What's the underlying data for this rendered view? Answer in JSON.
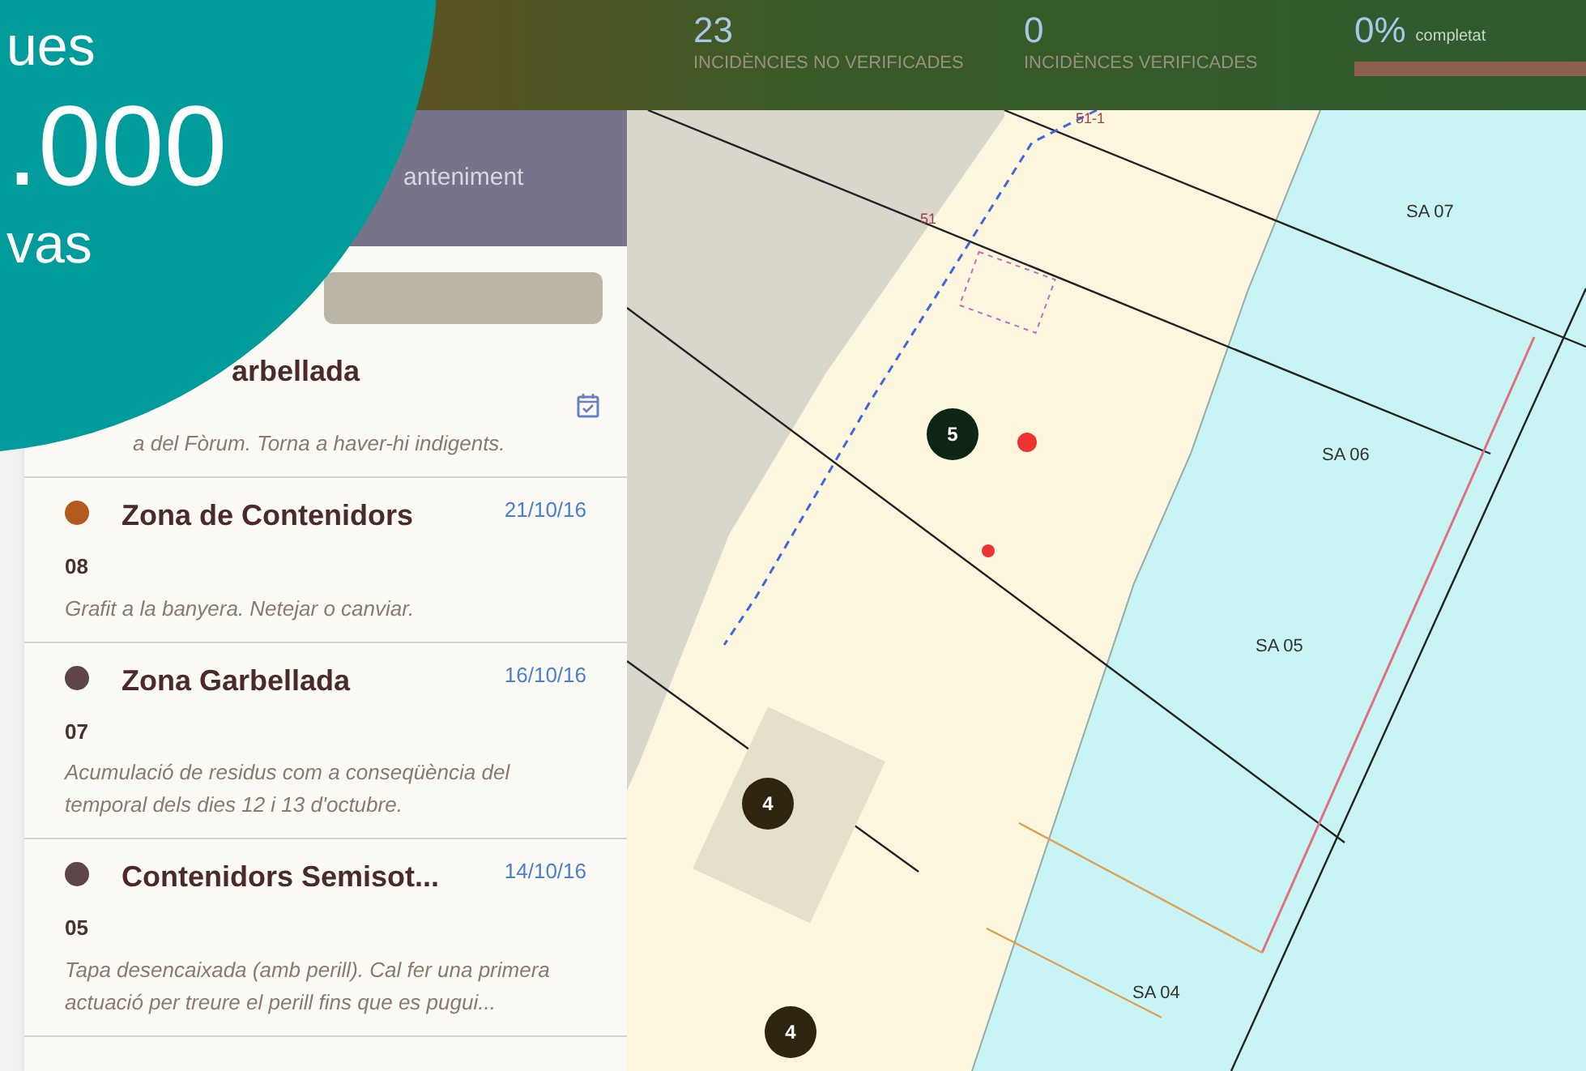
{
  "promo_overlay": {
    "lines": [
      "ues",
      ".000",
      "vas"
    ]
  },
  "stats": [
    {
      "value": "23",
      "label": "INCIDÈNCIES NO VERIFICADES"
    },
    {
      "value": "0",
      "label": "INCIDÈNCES VERIFICADES"
    }
  ],
  "progress": {
    "value": "0%",
    "label": "completat",
    "level": 0
  },
  "sidebar": {
    "header_title": "anteniment"
  },
  "incidents": [
    {
      "title": "arbellada",
      "description": "a del Fòrum. Torna a haver-hi indigents.",
      "calendar_icon": true
    },
    {
      "title": "Zona de Contenidors",
      "date": "21/10/16",
      "number": "08",
      "description": "Grafit a la banyera. Netejar o canviar.",
      "color": "#b35a1f",
      "calendar_icon": false
    },
    {
      "title": "Zona Garbellada",
      "date": "16/10/16",
      "number": "07",
      "description": "Acumulació de residus com a conseqüència del temporal dels dies 12 i 13 d'octubre.",
      "color": "#5e4548",
      "calendar_icon": false
    },
    {
      "title": "Contenidors Semisot...",
      "date": "14/10/16",
      "number": "05",
      "description": "Tapa desencaixada (amb perill). Cal fer una primera actuació per treure el perill fins que es pugui...",
      "color": "#5e4548",
      "calendar_icon": false
    }
  ],
  "map": {
    "zones": [
      "SA 07",
      "SA 06",
      "SA 05",
      "SA 04"
    ],
    "plot_labels": [
      "51-1",
      "51"
    ],
    "clusters": [
      "5",
      "4",
      "4"
    ]
  }
}
